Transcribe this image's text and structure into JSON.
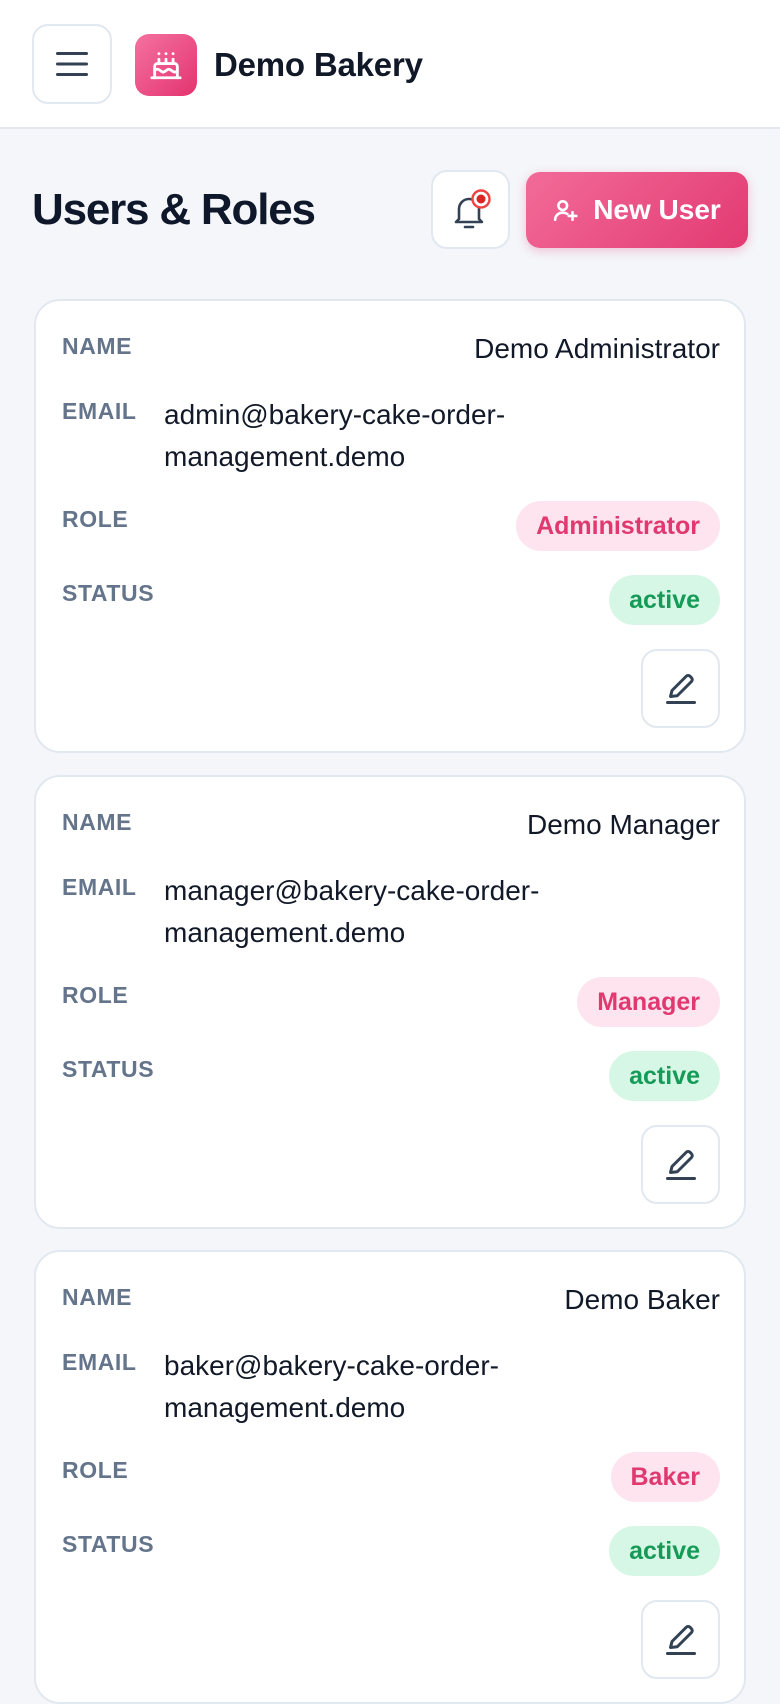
{
  "app": {
    "brand_name": "Demo Bakery",
    "brand_icon": "cake-icon",
    "menu_icon": "hamburger-menu-icon"
  },
  "header": {
    "title": "Users & Roles",
    "notification_icon": "bell-icon",
    "notification_has_badge": true,
    "new_user_label": "New User",
    "new_user_icon": "user-plus-icon"
  },
  "field_labels": {
    "name": "NAME",
    "email": "EMAIL",
    "role": "ROLE",
    "status": "STATUS"
  },
  "users": [
    {
      "name": "Demo Administrator",
      "email_line1": "admin@bakery-cake-order-",
      "email_line2": "management.demo",
      "role": "Administrator",
      "status": "active"
    },
    {
      "name": "Demo Manager",
      "email_line1": "manager@bakery-cake-order-",
      "email_line2": "management.demo",
      "role": "Manager",
      "status": "active"
    },
    {
      "name": "Demo Baker",
      "email_line1": "baker@bakery-cake-order-",
      "email_line2": "management.demo",
      "role": "Baker",
      "status": "active"
    }
  ],
  "colors": {
    "accent": "#e23a72",
    "role_badge_bg": "#fde4ee",
    "status_active_bg": "#d6f7e5",
    "status_active_text": "#159a58"
  }
}
